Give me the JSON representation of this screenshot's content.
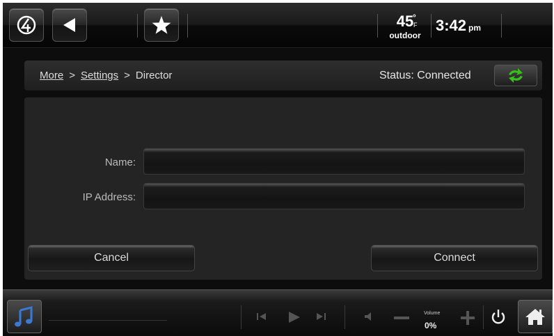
{
  "topbar": {
    "temperature": "45",
    "temperature_unit": "F",
    "temperature_label": "outdoor",
    "time": "3:42",
    "ampm": "pm",
    "icons": [
      "control4-logo-icon",
      "back-arrow-icon",
      "favorites-star-icon"
    ]
  },
  "breadcrumb": {
    "items": [
      "More",
      "Settings",
      "Director"
    ],
    "separator": ">"
  },
  "status": {
    "text": "Status: Connected",
    "icon": "refresh-icon",
    "icon_color": "#36c21b"
  },
  "form": {
    "name_label": "Name:",
    "name_value": "",
    "ip_label": "IP Address:",
    "ip_value": "",
    "cancel_label": "Cancel",
    "connect_label": "Connect"
  },
  "bottombar": {
    "music_icon": "music-note-icon",
    "music_icon_color": "#3a79d6",
    "volume_label": "Volume",
    "volume_value": "0%",
    "controls": [
      "previous-track-icon",
      "play-icon",
      "next-track-icon",
      "speaker-icon",
      "volume-down-icon",
      "volume-up-icon",
      "power-icon",
      "home-icon"
    ]
  }
}
